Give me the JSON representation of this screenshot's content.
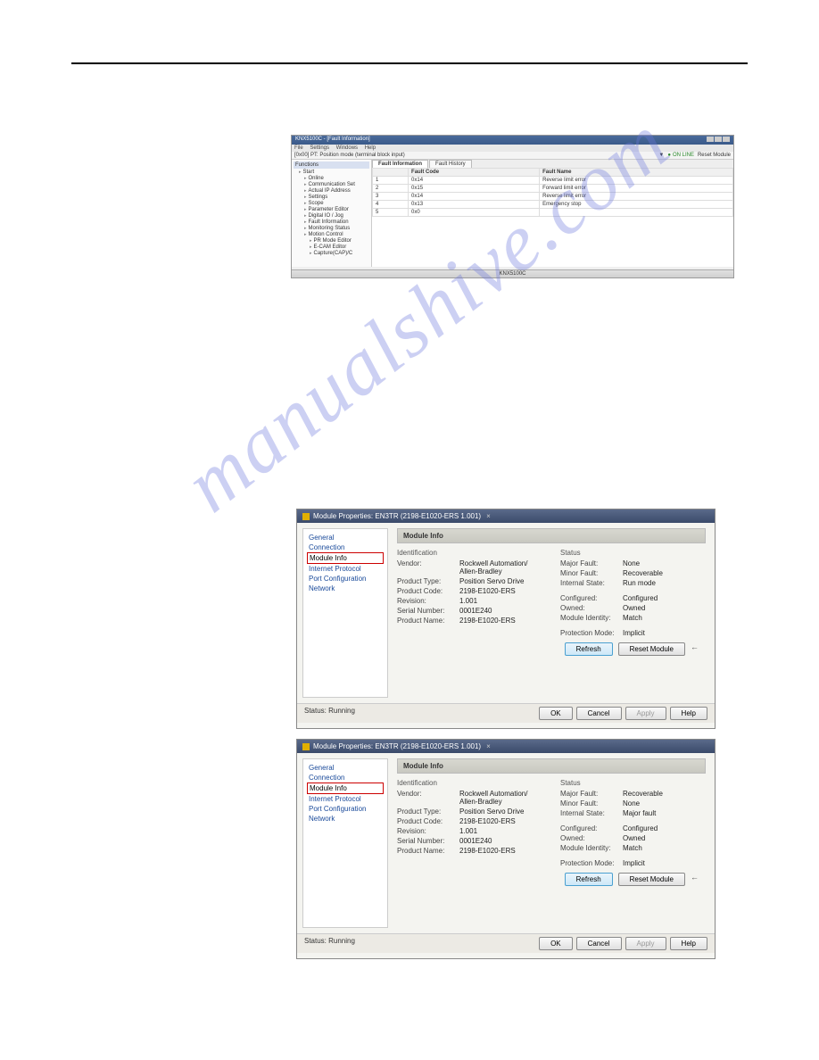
{
  "watermark": "manualshive.com",
  "app1": {
    "title": "KNX5100C - [Fault Information]",
    "menu": [
      "File",
      "Settings",
      "Windows",
      "Help"
    ],
    "mode": "[0x00] PT: Position mode (terminal block input)",
    "online": "ON LINE",
    "reset": "Reset Module",
    "tree_label": "Functions",
    "tree": {
      "root": "Start",
      "items": [
        "Online",
        "Communication Set",
        "Actual IP Address",
        "Settings",
        "Scope",
        "Parameter Editor",
        "Digital IO / Jog",
        "Fault Information",
        "Monitoring Status"
      ],
      "motion": "Motion Control",
      "motion_items": [
        "PR Mode Editor",
        "E-CAM Editor",
        "Capture(CAP)/C"
      ]
    },
    "tabs": {
      "info": "Fault Information",
      "history": "Fault History"
    },
    "cols": {
      "idx": "",
      "code": "Fault Code",
      "name": "Fault Name"
    },
    "rows": [
      {
        "i": "1",
        "c": "0x14",
        "n": "Reverse limit error"
      },
      {
        "i": "2",
        "c": "0x15",
        "n": "Forward limit error"
      },
      {
        "i": "3",
        "c": "0x14",
        "n": "Reverse limit error"
      },
      {
        "i": "4",
        "c": "0x13",
        "n": "Emergency stop"
      },
      {
        "i": "5",
        "c": "0x0",
        "n": ""
      }
    ],
    "status": "KNX5100C"
  },
  "dlg": {
    "title": "Module Properties: EN3TR (2198-E1020-ERS 1.001)",
    "side": [
      "General",
      "Connection",
      "Module Info",
      "Internet Protocol",
      "Port Configuration",
      "Network"
    ],
    "header": "Module Info",
    "id_label": "Identification",
    "status_label": "Status",
    "id_rows": [
      {
        "k": "Vendor:",
        "v": "Rockwell Automation/ Allen-Bradley"
      },
      {
        "k": "Product Type:",
        "v": "Position Servo Drive"
      },
      {
        "k": "Product Code:",
        "v": "2198-E1020-ERS"
      },
      {
        "k": "Revision:",
        "v": "1.001"
      },
      {
        "k": "Serial Number:",
        "v": "0001E240"
      },
      {
        "k": "Product Name:",
        "v": "2198-E1020-ERS"
      }
    ],
    "status2_rows": [
      {
        "k": "Major Fault:",
        "v": "None"
      },
      {
        "k": "Minor Fault:",
        "v": "Recoverable"
      },
      {
        "k": "Internal State:",
        "v": "Run mode"
      },
      {
        "k": "Configured:",
        "v": "Configured"
      },
      {
        "k": "Owned:",
        "v": "Owned"
      },
      {
        "k": "Module Identity:",
        "v": "Match"
      },
      {
        "k": "Protection Mode:",
        "v": "Implicit"
      }
    ],
    "status3_rows": [
      {
        "k": "Major Fault:",
        "v": "Recoverable"
      },
      {
        "k": "Minor Fault:",
        "v": "None"
      },
      {
        "k": "Internal State:",
        "v": "Major fault"
      },
      {
        "k": "Configured:",
        "v": "Configured"
      },
      {
        "k": "Owned:",
        "v": "Owned"
      },
      {
        "k": "Module Identity:",
        "v": "Match"
      },
      {
        "k": "Protection Mode:",
        "v": "Implicit"
      }
    ],
    "refresh": "Refresh",
    "reset": "Reset Module",
    "status_text": "Status: Running",
    "ok": "OK",
    "cancel": "Cancel",
    "apply": "Apply",
    "help": "Help"
  }
}
